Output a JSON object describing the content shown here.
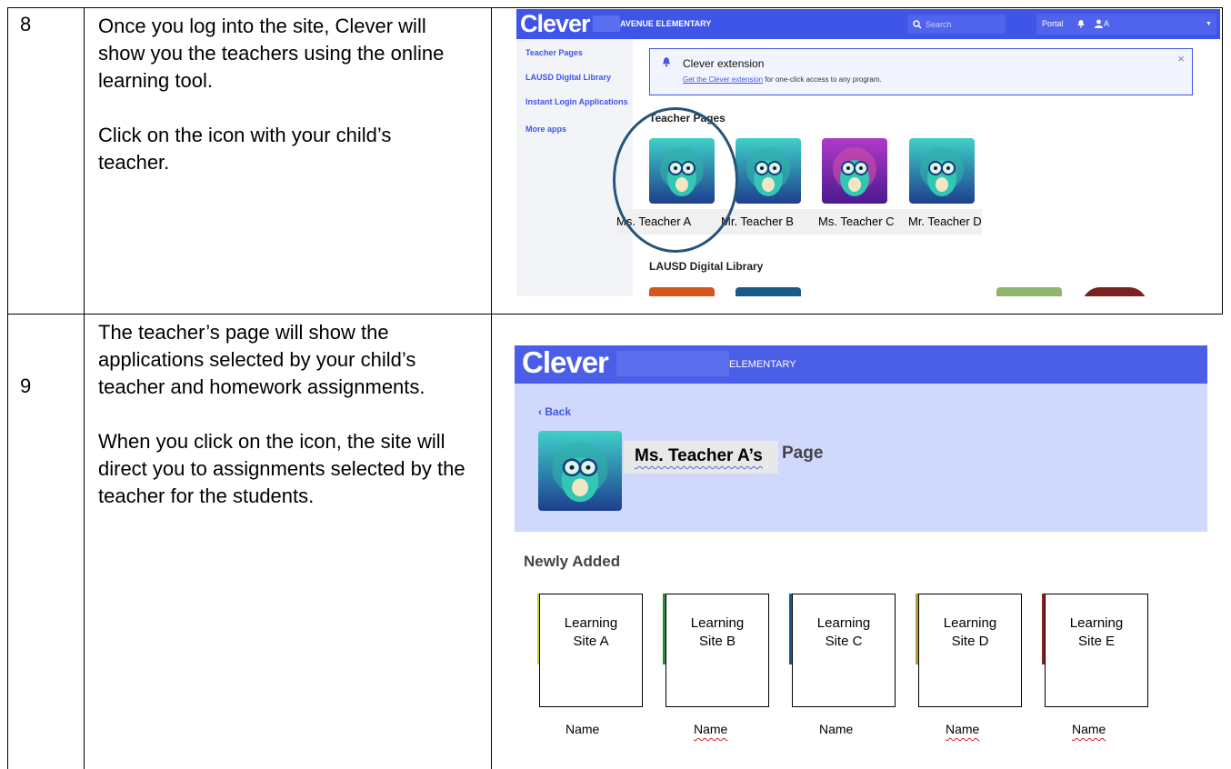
{
  "rows": [
    {
      "number": "8",
      "paragraphs": [
        "Once you log into the site, Clever will show you the teachers using the online learning tool.",
        "Click on the icon with your child’s teacher."
      ]
    },
    {
      "number": "9",
      "paragraphs": [
        "The teacher’s page will show the applications selected by your child’s teacher and homework assignments.",
        "When you click on the icon, the site will direct you to assignments selected by the teacher for the students."
      ]
    }
  ],
  "shot1": {
    "logo": "Clever",
    "school": "AVENUE ELEMENTARY",
    "search_placeholder": "Search",
    "portal": "Portal",
    "user_initial": "A",
    "sidebar": [
      "Teacher Pages",
      "LAUSD Digital Library",
      "Instant Login Applications",
      "More apps"
    ],
    "extension_title": "Clever extension",
    "extension_link": "Get the Clever extension",
    "extension_rest": " for one-click access to any program.",
    "section_teacher_pages": "Teacher Pages",
    "teachers": [
      "Ms. Teacher A",
      "Mr. Teacher B",
      "Ms. Teacher C",
      "Mr. Teacher D"
    ],
    "section_library": "LAUSD Digital Library",
    "colors": {
      "header": "#3f55e8",
      "ring": "#27547a"
    }
  },
  "shot2": {
    "logo": "Clever",
    "school": "ELEMENTARY",
    "back": "Back",
    "teacher_name": "Ms. Teacher A’s",
    "page_word": "Page",
    "newly_added": "Newly Added",
    "sites": [
      {
        "line1": "Learning",
        "line2": "Site A",
        "name": "Name"
      },
      {
        "line1": "Learning",
        "line2": "Site B",
        "name": "Name"
      },
      {
        "line1": "Learning",
        "line2": "Site C",
        "name": "Name"
      },
      {
        "line1": "Learning",
        "line2": "Site D",
        "name": "Name"
      },
      {
        "line1": "Learning",
        "line2": "Site E",
        "name": "Name"
      }
    ],
    "colors": {
      "header": "#4a5ee8",
      "banner": "#d0d8fc"
    }
  }
}
